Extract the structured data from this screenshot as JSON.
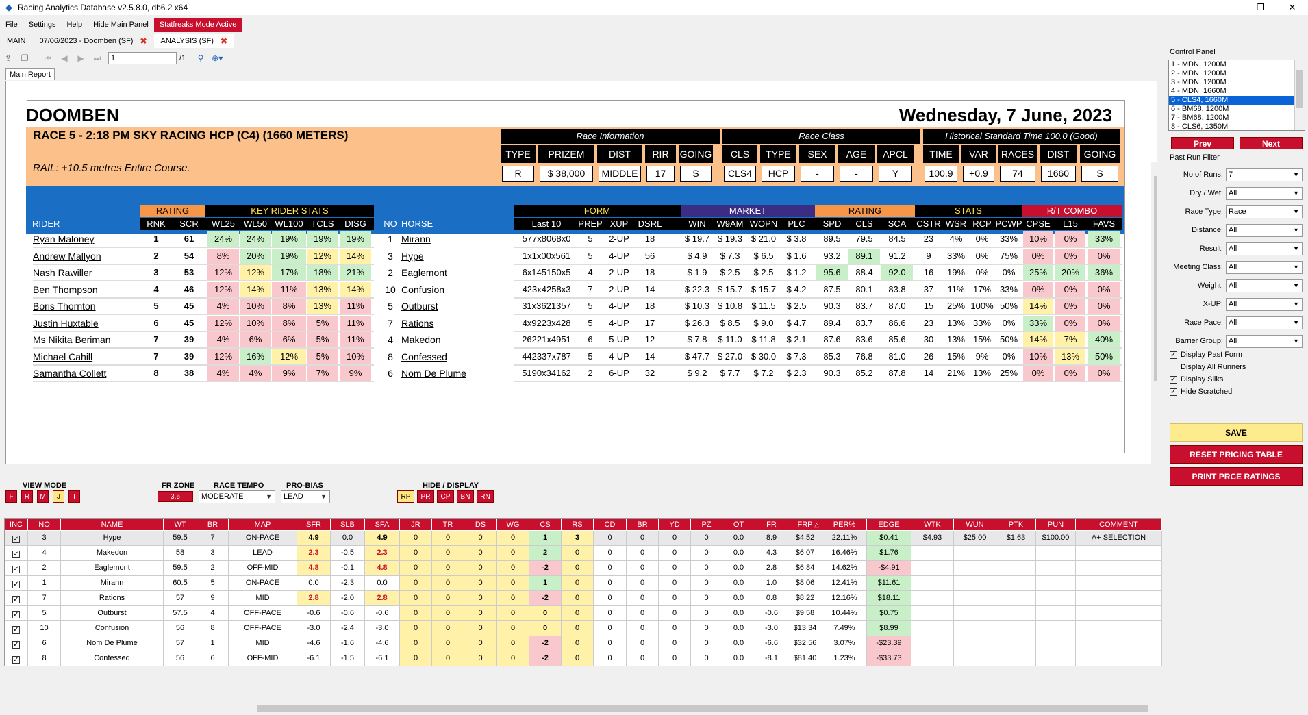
{
  "window": {
    "title": "Racing Analytics Database v2.5.8.0, db6.2 x64"
  },
  "menu": [
    "File",
    "Settings",
    "Help",
    "Hide Main Panel",
    "Statfreaks Mode Active"
  ],
  "tabs": [
    {
      "label": "MAIN"
    },
    {
      "label": "07/06/2023 - Doomben (SF)"
    },
    {
      "label": "ANALYSIS (SF)"
    }
  ],
  "toolbar": {
    "page_value": "1",
    "page_total": "/1"
  },
  "report_tab": "Main Report",
  "report": {
    "venue": "DOOMBEN",
    "date": "Wednesday, 7 June, 2023",
    "race_title": "RACE 5 - 2:18 PM SKY RACING HCP (C4) (1660 METERS)",
    "rail": "RAIL: +10.5 metres Entire Course.",
    "race_info_title": "Race Information",
    "race_class_title": "Race Class",
    "hist_title": "Historical Standard Time 100.0 (Good)",
    "info_headers": [
      "TYPE",
      "PRIZEM",
      "DIST",
      "RIR",
      "GOING",
      "CLS",
      "TYPE",
      "SEX",
      "AGE",
      "APCL",
      "TIME",
      "VAR",
      "RACES",
      "DIST",
      "GOING"
    ],
    "info_values": [
      "R",
      "$ 38,000",
      "MIDDLE",
      "17",
      "S",
      "CLS4",
      "HCP",
      "-",
      "-",
      "Y",
      "100.9",
      "+0.9",
      "74",
      "1660",
      "S"
    ],
    "groups": {
      "rating": "RATING",
      "key": "KEY RIDER STATS",
      "form": "FORM",
      "market": "MARKET",
      "rating2": "RATING",
      "stats": "STATS",
      "rt": "R/T COMBO"
    },
    "col_headers": {
      "rider": "RIDER",
      "rnk": "RNK",
      "scr": "SCR",
      "wl25": "WL25",
      "wl50": "WL50",
      "wl100": "WL100",
      "tcls": "TCLS",
      "disg": "DISG",
      "no": "NO",
      "horse": "HORSE",
      "last10": "Last 10",
      "prep": "PREP",
      "xup": "XUP",
      "dsrl": "DSRL",
      "win": "WIN",
      "w9am": "W9AM",
      "wopn": "WOPN",
      "plc": "PLC",
      "spd": "SPD",
      "cls": "CLS",
      "sca": "SCA",
      "cstr": "CSTR",
      "wsr": "WSR",
      "rcp": "RCP",
      "pcwp": "PCWP",
      "cpse": "CPSE",
      "l15": "L15",
      "favs": "FAVS"
    },
    "riders": [
      {
        "rider": "Ryan Maloney",
        "rnk": "1",
        "scr": "61",
        "wl25": "24%",
        "wl50": "24%",
        "wl100": "19%",
        "tcls": "19%",
        "disg": "19%",
        "c": [
          "g",
          "g",
          "g",
          "g",
          "g"
        ]
      },
      {
        "rider": "Andrew Mallyon",
        "rnk": "2",
        "scr": "54",
        "wl25": "8%",
        "wl50": "20%",
        "wl100": "19%",
        "tcls": "12%",
        "disg": "14%",
        "c": [
          "p",
          "g",
          "g",
          "y",
          "y"
        ]
      },
      {
        "rider": "Nash Rawiller",
        "rnk": "3",
        "scr": "53",
        "wl25": "12%",
        "wl50": "12%",
        "wl100": "17%",
        "tcls": "18%",
        "disg": "21%",
        "c": [
          "p",
          "y",
          "g",
          "g",
          "g"
        ]
      },
      {
        "rider": "Ben Thompson",
        "rnk": "4",
        "scr": "46",
        "wl25": "12%",
        "wl50": "14%",
        "wl100": "11%",
        "tcls": "13%",
        "disg": "14%",
        "c": [
          "p",
          "y",
          "p",
          "y",
          "y"
        ]
      },
      {
        "rider": "Boris Thornton",
        "rnk": "5",
        "scr": "45",
        "wl25": "4%",
        "wl50": "10%",
        "wl100": "8%",
        "tcls": "13%",
        "disg": "11%",
        "c": [
          "p",
          "p",
          "p",
          "y",
          "p"
        ]
      },
      {
        "rider": "Justin Huxtable",
        "rnk": "6",
        "scr": "45",
        "wl25": "12%",
        "wl50": "10%",
        "wl100": "8%",
        "tcls": "5%",
        "disg": "11%",
        "c": [
          "p",
          "p",
          "p",
          "p",
          "p"
        ]
      },
      {
        "rider": "Ms Nikita Beriman",
        "rnk": "7",
        "scr": "39",
        "wl25": "4%",
        "wl50": "6%",
        "wl100": "6%",
        "tcls": "5%",
        "disg": "11%",
        "c": [
          "p",
          "p",
          "p",
          "p",
          "p"
        ]
      },
      {
        "rider": "Michael Cahill",
        "rnk": "7",
        "scr": "39",
        "wl25": "12%",
        "wl50": "16%",
        "wl100": "12%",
        "tcls": "5%",
        "disg": "10%",
        "c": [
          "p",
          "g",
          "y",
          "p",
          "p"
        ]
      },
      {
        "rider": "Samantha Collett",
        "rnk": "8",
        "scr": "38",
        "wl25": "4%",
        "wl50": "4%",
        "wl100": "9%",
        "tcls": "7%",
        "disg": "9%",
        "c": [
          "p",
          "p",
          "p",
          "p",
          "p"
        ]
      }
    ],
    "horses": [
      {
        "no": "1",
        "horse": "Mirann",
        "last10": "577x8068x0",
        "prep": "5",
        "xup": "2-UP",
        "dsrl": "18",
        "win": "$ 19.7",
        "w9am": "$ 19.3",
        "wopn": "$ 21.0",
        "plc": "$ 3.8",
        "spd": "89.5",
        "cls": "79.5",
        "sca": "84.5",
        "cstr": "23",
        "wsr": "4%",
        "rcp": "0%",
        "pcwp": "33%",
        "cpse": "10%",
        "l15": "0%",
        "favs": "33%",
        "c": [
          "",
          "",
          "",
          "",
          "",
          "",
          "",
          "g"
        ],
        "rc": [
          "p",
          "p",
          "g"
        ]
      },
      {
        "no": "3",
        "horse": "Hype",
        "last10": "1x1x00x561",
        "prep": "5",
        "xup": "4-UP",
        "dsrl": "56",
        "win": "$ 4.9",
        "w9am": "$ 7.3",
        "wopn": "$ 6.5",
        "plc": "$ 1.6",
        "spd": "93.2",
        "cls": "89.1",
        "sca": "91.2",
        "cstr": "9",
        "wsr": "33%",
        "rcp": "0%",
        "pcwp": "75%",
        "cpse": "0%",
        "l15": "0%",
        "favs": "0%",
        "c": [
          "",
          "g",
          ""
        ],
        "rc": [
          "p",
          "p",
          "p"
        ]
      },
      {
        "no": "2",
        "horse": "Eaglemont",
        "last10": "6x145150x5",
        "prep": "4",
        "xup": "2-UP",
        "dsrl": "18",
        "win": "$ 1.9",
        "w9am": "$ 2.5",
        "wopn": "$ 2.5",
        "plc": "$ 1.2",
        "spd": "95.6",
        "cls": "88.4",
        "sca": "92.0",
        "cstr": "16",
        "wsr": "19%",
        "rcp": "0%",
        "pcwp": "0%",
        "cpse": "25%",
        "l15": "20%",
        "favs": "36%",
        "c": [
          "g",
          "",
          "g"
        ],
        "rc": [
          "g",
          "g",
          "g"
        ]
      },
      {
        "no": "10",
        "horse": "Confusion",
        "last10": "423x4258x3",
        "prep": "7",
        "xup": "2-UP",
        "dsrl": "14",
        "win": "$ 22.3",
        "w9am": "$ 15.7",
        "wopn": "$ 15.7",
        "plc": "$ 4.2",
        "spd": "87.5",
        "cls": "80.1",
        "sca": "83.8",
        "cstr": "37",
        "wsr": "11%",
        "rcp": "17%",
        "pcwp": "33%",
        "cpse": "0%",
        "l15": "0%",
        "favs": "0%",
        "c": [
          "",
          "",
          ""
        ],
        "rc": [
          "p",
          "p",
          "p"
        ]
      },
      {
        "no": "5",
        "horse": "Outburst",
        "last10": "31x3621357",
        "prep": "5",
        "xup": "4-UP",
        "dsrl": "18",
        "win": "$ 10.3",
        "w9am": "$ 10.8",
        "wopn": "$ 11.5",
        "plc": "$ 2.5",
        "spd": "90.3",
        "cls": "83.7",
        "sca": "87.0",
        "cstr": "15",
        "wsr": "25%",
        "rcp": "100%",
        "pcwp": "50%",
        "cpse": "14%",
        "l15": "0%",
        "favs": "0%",
        "c": [
          "",
          "",
          ""
        ],
        "rc": [
          "y",
          "p",
          "p"
        ]
      },
      {
        "no": "7",
        "horse": "Rations",
        "last10": "4x9223x428",
        "prep": "5",
        "xup": "4-UP",
        "dsrl": "17",
        "win": "$ 26.3",
        "w9am": "$ 8.5",
        "wopn": "$ 9.0",
        "plc": "$ 4.7",
        "spd": "89.4",
        "cls": "83.7",
        "sca": "86.6",
        "cstr": "23",
        "wsr": "13%",
        "rcp": "33%",
        "pcwp": "0%",
        "cpse": "33%",
        "l15": "0%",
        "favs": "0%",
        "c": [
          "",
          "",
          ""
        ],
        "rc": [
          "g",
          "p",
          "p"
        ]
      },
      {
        "no": "4",
        "horse": "Makedon",
        "last10": "26221x4951",
        "prep": "6",
        "xup": "5-UP",
        "dsrl": "12",
        "win": "$ 7.8",
        "w9am": "$ 11.0",
        "wopn": "$ 11.8",
        "plc": "$ 2.1",
        "spd": "87.6",
        "cls": "83.6",
        "sca": "85.6",
        "cstr": "30",
        "wsr": "13%",
        "rcp": "15%",
        "pcwp": "50%",
        "cpse": "14%",
        "l15": "7%",
        "favs": "40%",
        "c": [
          "",
          "",
          ""
        ],
        "rc": [
          "y",
          "y",
          "g"
        ]
      },
      {
        "no": "8",
        "horse": "Confessed",
        "last10": "442337x787",
        "prep": "5",
        "xup": "4-UP",
        "dsrl": "14",
        "win": "$ 47.7",
        "w9am": "$ 27.0",
        "wopn": "$ 30.0",
        "plc": "$ 7.3",
        "spd": "85.3",
        "cls": "76.8",
        "sca": "81.0",
        "cstr": "26",
        "wsr": "15%",
        "rcp": "9%",
        "pcwp": "0%",
        "cpse": "10%",
        "l15": "13%",
        "favs": "50%",
        "c": [
          "",
          "",
          ""
        ],
        "rc": [
          "p",
          "y",
          "g"
        ]
      },
      {
        "no": "6",
        "horse": "Nom De Plume",
        "last10": "5190x34162",
        "prep": "2",
        "xup": "6-UP",
        "dsrl": "32",
        "win": "$ 9.2",
        "w9am": "$ 7.7",
        "wopn": "$ 7.2",
        "plc": "$ 2.3",
        "spd": "90.3",
        "cls": "85.2",
        "sca": "87.8",
        "cstr": "14",
        "wsr": "21%",
        "rcp": "13%",
        "pcwp": "25%",
        "cpse": "0%",
        "l15": "0%",
        "favs": "0%",
        "c": [
          "",
          "",
          ""
        ],
        "rc": [
          "p",
          "p",
          "p"
        ]
      }
    ]
  },
  "controls": {
    "view_mode_label": "VIEW MODE",
    "view_modes": [
      "F",
      "R",
      "M",
      "J",
      "T"
    ],
    "view_mode_selected": "J",
    "fr_zone_label": "FR ZONE",
    "fr_zone": "3.6",
    "race_tempo_label": "RACE TEMPO",
    "race_tempo": "MODERATE",
    "pro_bias_label": "PRO-BIAS",
    "pro_bias": "LEAD",
    "hide_display_label": "HIDE / DISPLAY",
    "hide_display": [
      "RP",
      "PR",
      "CP",
      "BN",
      "RN"
    ]
  },
  "grid": {
    "headers": [
      "INC",
      "NO",
      "NAME",
      "WT",
      "BR",
      "MAP",
      "SFR",
      "SLB",
      "SFA",
      "JR",
      "TR",
      "DS",
      "WG",
      "CS",
      "RS",
      "CD",
      "BR",
      "YD",
      "PZ",
      "OT",
      "FR",
      "FRP",
      "PER%",
      "EDGE",
      "WTK",
      "WUN",
      "PTK",
      "PUN",
      "COMMENT"
    ],
    "sort_marker": "△",
    "rows": [
      {
        "no": "3",
        "name": "Hype",
        "wt": "59.5",
        "br": "7",
        "map": "ON-PACE",
        "sfr": "4.9",
        "slb": "0.0",
        "sfa": "4.9",
        "jr": "0",
        "tr": "0",
        "ds": "0",
        "wg": "0",
        "cs": "1",
        "rs": "3",
        "cd": "0",
        "br2": "0",
        "yd": "0",
        "pz": "0",
        "ot": "0.0",
        "fr": "8.9",
        "frp": "$4.52",
        "per": "22.11%",
        "edge": "$0.41",
        "wtk": "$4.93",
        "wun": "$25.00",
        "ptk": "$1.63",
        "pun": "$100.00",
        "comment": "A+ SELECTION"
      },
      {
        "no": "4",
        "name": "Makedon",
        "wt": "58",
        "br": "3",
        "map": "LEAD",
        "sfr": "2.3",
        "slb": "-0.5",
        "sfa": "2.3",
        "jr": "0",
        "tr": "0",
        "ds": "0",
        "wg": "0",
        "cs": "2",
        "rs": "0",
        "cd": "0",
        "br2": "0",
        "yd": "0",
        "pz": "0",
        "ot": "0.0",
        "fr": "4.3",
        "frp": "$6.07",
        "per": "16.46%",
        "edge": "$1.76",
        "wtk": "",
        "wun": "",
        "ptk": "",
        "pun": "",
        "comment": ""
      },
      {
        "no": "2",
        "name": "Eaglemont",
        "wt": "59.5",
        "br": "2",
        "map": "OFF-MID",
        "sfr": "4.8",
        "slb": "-0.1",
        "sfa": "4.8",
        "jr": "0",
        "tr": "0",
        "ds": "0",
        "wg": "0",
        "cs": "-2",
        "rs": "0",
        "cd": "0",
        "br2": "0",
        "yd": "0",
        "pz": "0",
        "ot": "0.0",
        "fr": "2.8",
        "frp": "$6.84",
        "per": "14.62%",
        "edge": "-$4.91",
        "wtk": "",
        "wun": "",
        "ptk": "",
        "pun": "",
        "comment": ""
      },
      {
        "no": "1",
        "name": "Mirann",
        "wt": "60.5",
        "br": "5",
        "map": "ON-PACE",
        "sfr": "0.0",
        "slb": "-2.3",
        "sfa": "0.0",
        "jr": "0",
        "tr": "0",
        "ds": "0",
        "wg": "0",
        "cs": "1",
        "rs": "0",
        "cd": "0",
        "br2": "0",
        "yd": "0",
        "pz": "0",
        "ot": "0.0",
        "fr": "1.0",
        "frp": "$8.06",
        "per": "12.41%",
        "edge": "$11.61",
        "wtk": "",
        "wun": "",
        "ptk": "",
        "pun": "",
        "comment": ""
      },
      {
        "no": "7",
        "name": "Rations",
        "wt": "57",
        "br": "9",
        "map": "MID",
        "sfr": "2.8",
        "slb": "-2.0",
        "sfa": "2.8",
        "jr": "0",
        "tr": "0",
        "ds": "0",
        "wg": "0",
        "cs": "-2",
        "rs": "0",
        "cd": "0",
        "br2": "0",
        "yd": "0",
        "pz": "0",
        "ot": "0.0",
        "fr": "0.8",
        "frp": "$8.22",
        "per": "12.16%",
        "edge": "$18.11",
        "wtk": "",
        "wun": "",
        "ptk": "",
        "pun": "",
        "comment": ""
      },
      {
        "no": "5",
        "name": "Outburst",
        "wt": "57.5",
        "br": "4",
        "map": "OFF-PACE",
        "sfr": "-0.6",
        "slb": "-0.6",
        "sfa": "-0.6",
        "jr": "0",
        "tr": "0",
        "ds": "0",
        "wg": "0",
        "cs": "0",
        "rs": "0",
        "cd": "0",
        "br2": "0",
        "yd": "0",
        "pz": "0",
        "ot": "0.0",
        "fr": "-0.6",
        "frp": "$9.58",
        "per": "10.44%",
        "edge": "$0.75",
        "wtk": "",
        "wun": "",
        "ptk": "",
        "pun": "",
        "comment": ""
      },
      {
        "no": "10",
        "name": "Confusion",
        "wt": "56",
        "br": "8",
        "map": "OFF-PACE",
        "sfr": "-3.0",
        "slb": "-2.4",
        "sfa": "-3.0",
        "jr": "0",
        "tr": "0",
        "ds": "0",
        "wg": "0",
        "cs": "0",
        "rs": "0",
        "cd": "0",
        "br2": "0",
        "yd": "0",
        "pz": "0",
        "ot": "0.0",
        "fr": "-3.0",
        "frp": "$13.34",
        "per": "7.49%",
        "edge": "$8.99",
        "wtk": "",
        "wun": "",
        "ptk": "",
        "pun": "",
        "comment": ""
      },
      {
        "no": "6",
        "name": "Nom De Plume",
        "wt": "57",
        "br": "1",
        "map": "MID",
        "sfr": "-4.6",
        "slb": "-1.6",
        "sfa": "-4.6",
        "jr": "0",
        "tr": "0",
        "ds": "0",
        "wg": "0",
        "cs": "-2",
        "rs": "0",
        "cd": "0",
        "br2": "0",
        "yd": "0",
        "pz": "0",
        "ot": "0.0",
        "fr": "-6.6",
        "frp": "$32.56",
        "per": "3.07%",
        "edge": "-$23.39",
        "wtk": "",
        "wun": "",
        "ptk": "",
        "pun": "",
        "comment": ""
      },
      {
        "no": "8",
        "name": "Confessed",
        "wt": "56",
        "br": "6",
        "map": "OFF-MID",
        "sfr": "-6.1",
        "slb": "-1.5",
        "sfa": "-6.1",
        "jr": "0",
        "tr": "0",
        "ds": "0",
        "wg": "0",
        "cs": "-2",
        "rs": "0",
        "cd": "0",
        "br2": "0",
        "yd": "0",
        "pz": "0",
        "ot": "0.0",
        "fr": "-8.1",
        "frp": "$81.40",
        "per": "1.23%",
        "edge": "-$33.73",
        "wtk": "",
        "wun": "",
        "ptk": "",
        "pun": "",
        "comment": ""
      }
    ]
  },
  "control_panel": {
    "title": "Control Panel",
    "races": [
      "1 - MDN, 1200M",
      "2 - MDN, 1200M",
      "3 - MDN, 1200M",
      "4 - MDN, 1660M",
      "5 - CLS4, 1660M",
      "6 - BM68, 1200M",
      "7 - BM68, 1200M",
      "8 - CLS6, 1350M"
    ],
    "selected_race": 4,
    "prev": "Prev",
    "next": "Next",
    "filter_title": "Past Run Filter",
    "filters": [
      {
        "label": "No of Runs:",
        "value": "7"
      },
      {
        "label": "Dry / Wet:",
        "value": "All"
      },
      {
        "label": "Race Type:",
        "value": "Race"
      },
      {
        "label": "Distance:",
        "value": "All"
      },
      {
        "label": "Result:",
        "value": "All"
      },
      {
        "label": "Meeting Class:",
        "value": "All"
      },
      {
        "label": "Weight:",
        "value": "All"
      },
      {
        "label": "X-UP:",
        "value": "All"
      },
      {
        "label": "Race Pace:",
        "value": "All"
      },
      {
        "label": "Barrier Group:",
        "value": "All"
      }
    ],
    "checkboxes": [
      {
        "label": "Display Past Form",
        "checked": true
      },
      {
        "label": "Display All Runners",
        "checked": false
      },
      {
        "label": "Display Silks",
        "checked": true
      },
      {
        "label": "Hide Scratched",
        "checked": true
      }
    ],
    "save": "SAVE",
    "reset": "RESET PRICING TABLE",
    "print": "PRINT PRCE RATINGS"
  },
  "colors": {
    "accent": "#c8102e",
    "peach": "#fcc08a",
    "blue": "#1a6fc4",
    "green": "#c8efc8",
    "yellow": "#fff2a8",
    "pink": "#f9c8cc"
  }
}
